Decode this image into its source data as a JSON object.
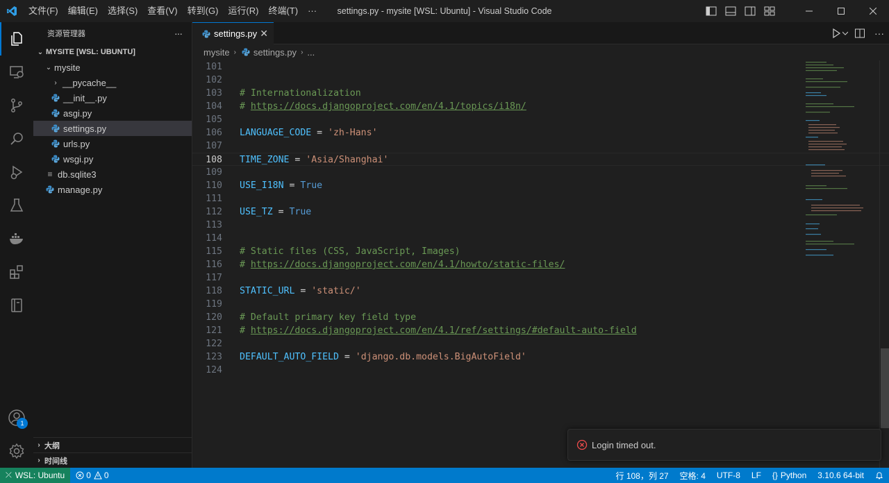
{
  "titlebar": {
    "menu": [
      "文件(F)",
      "编辑(E)",
      "选择(S)",
      "查看(V)",
      "转到(G)",
      "运行(R)",
      "终端(T)",
      "···"
    ],
    "title": "settings.py - mysite [WSL: Ubuntu] - Visual Studio Code"
  },
  "activity": {
    "accounts_badge": "1"
  },
  "sidebar": {
    "title": "资源管理器",
    "more": "···",
    "workspace": "MYSITE [WSL: UBUNTU]",
    "folder": "mysite",
    "items": [
      "__pycache__",
      "__init__.py",
      "asgi.py",
      "settings.py",
      "urls.py",
      "wsgi.py"
    ],
    "root_files": [
      "db.sqlite3",
      "manage.py"
    ],
    "sections": [
      "大纲",
      "时间线"
    ]
  },
  "editor": {
    "tab_label": "settings.py",
    "breadcrumb": [
      "mysite",
      "settings.py",
      "..."
    ],
    "lines": [
      {
        "n": "101",
        "parts": []
      },
      {
        "n": "102",
        "parts": []
      },
      {
        "n": "103",
        "parts": [
          [
            "c",
            "# Internationalization"
          ]
        ]
      },
      {
        "n": "104",
        "parts": [
          [
            "c",
            "# "
          ],
          [
            "l",
            "https://docs.djangoproject.com/en/4.1/topics/i18n/"
          ]
        ]
      },
      {
        "n": "105",
        "parts": []
      },
      {
        "n": "106",
        "parts": [
          [
            "v",
            "LANGUAGE_CODE"
          ],
          [
            "o",
            " = "
          ],
          [
            "s",
            "'zh-Hans'"
          ]
        ]
      },
      {
        "n": "107",
        "parts": []
      },
      {
        "n": "108",
        "parts": [
          [
            "v",
            "TIME_ZONE"
          ],
          [
            "o",
            " = "
          ],
          [
            "s",
            "'Asia/Shanghai'"
          ]
        ]
      },
      {
        "n": "109",
        "parts": []
      },
      {
        "n": "110",
        "parts": [
          [
            "v",
            "USE_I18N"
          ],
          [
            "o",
            " = "
          ],
          [
            "k",
            "True"
          ]
        ]
      },
      {
        "n": "111",
        "parts": []
      },
      {
        "n": "112",
        "parts": [
          [
            "v",
            "USE_TZ"
          ],
          [
            "o",
            " = "
          ],
          [
            "k",
            "True"
          ]
        ]
      },
      {
        "n": "113",
        "parts": []
      },
      {
        "n": "114",
        "parts": []
      },
      {
        "n": "115",
        "parts": [
          [
            "c",
            "# Static files (CSS, JavaScript, Images)"
          ]
        ]
      },
      {
        "n": "116",
        "parts": [
          [
            "c",
            "# "
          ],
          [
            "l",
            "https://docs.djangoproject.com/en/4.1/howto/static-files/"
          ]
        ]
      },
      {
        "n": "117",
        "parts": []
      },
      {
        "n": "118",
        "parts": [
          [
            "v",
            "STATIC_URL"
          ],
          [
            "o",
            " = "
          ],
          [
            "s",
            "'static/'"
          ]
        ]
      },
      {
        "n": "119",
        "parts": []
      },
      {
        "n": "120",
        "parts": [
          [
            "c",
            "# Default primary key field type"
          ]
        ]
      },
      {
        "n": "121",
        "parts": [
          [
            "c",
            "# "
          ],
          [
            "l",
            "https://docs.djangoproject.com/en/4.1/ref/settings/#default-auto-field"
          ]
        ]
      },
      {
        "n": "122",
        "parts": []
      },
      {
        "n": "123",
        "parts": [
          [
            "v",
            "DEFAULT_AUTO_FIELD"
          ],
          [
            "o",
            " = "
          ],
          [
            "s",
            "'django.db.models.BigAutoField'"
          ]
        ]
      },
      {
        "n": "124",
        "parts": []
      }
    ],
    "current_line": "108"
  },
  "notification": {
    "message": "Login timed out."
  },
  "statusbar": {
    "remote": "WSL: Ubuntu",
    "errors": "0",
    "warnings": "0",
    "position": "行 108，列 27",
    "indent": "空格: 4",
    "encoding": "UTF-8",
    "eol": "LF",
    "language": "Python",
    "interpreter": "3.10.6 64-bit"
  },
  "colors": {
    "accent": "#0078d4",
    "statusbar": "#007acc",
    "remote": "#16825d",
    "error": "#f14c4c"
  }
}
